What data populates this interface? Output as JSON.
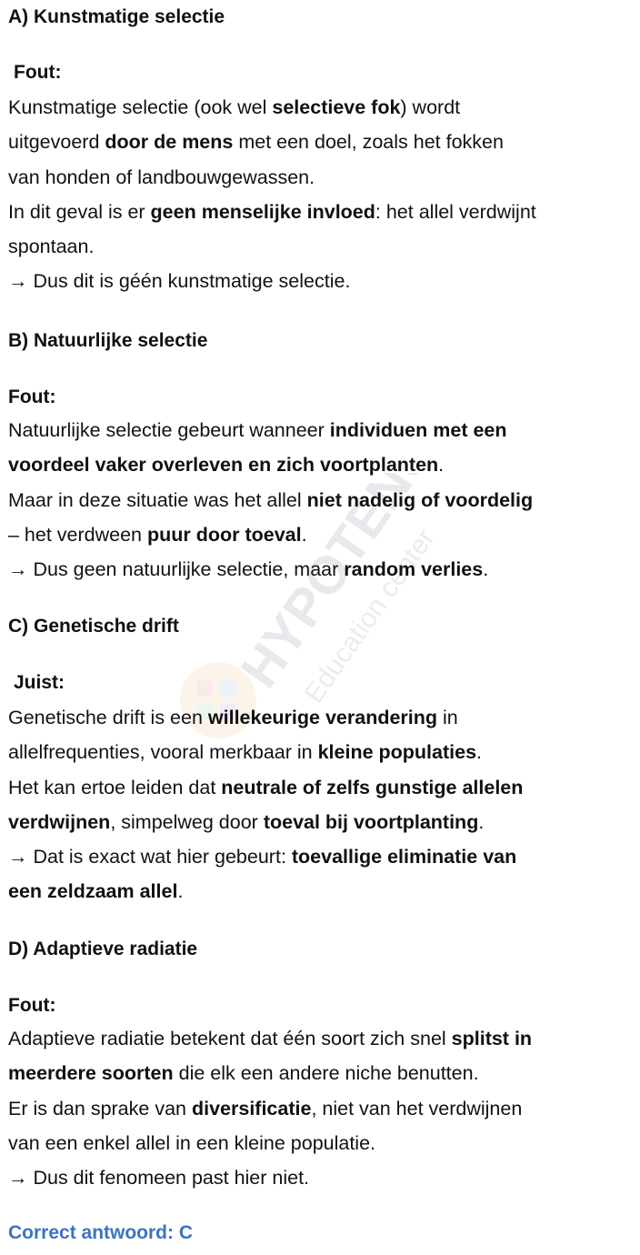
{
  "watermark": {
    "brand": "HYPOTENUSE",
    "subtitle": "Education center"
  },
  "sections": [
    {
      "title": "A) Kunstmatige selectie",
      "verdict": "Fout:",
      "lines": [
        [
          [
            "Kunstmatige selectie (ook wel ",
            false
          ],
          [
            "selectieve fok",
            true
          ],
          [
            ") wordt",
            false
          ]
        ],
        [
          [
            "uitgevoerd ",
            false
          ],
          [
            "door de mens",
            true
          ],
          [
            " met een doel, zoals het fokken",
            false
          ]
        ],
        [
          [
            "van honden of landbouwgewassen.",
            false
          ]
        ],
        [
          [
            "In dit geval is er ",
            false
          ],
          [
            "geen menselijke invloed",
            true
          ],
          [
            ": het allel verdwijnt",
            false
          ]
        ],
        [
          [
            "spontaan.",
            false
          ]
        ],
        [
          [
            "→ Dus dit is géén kunstmatige selectie.",
            false
          ]
        ]
      ]
    },
    {
      "title": "B) Natuurlijke selectie",
      "verdict": "Fout:",
      "lines": [
        [
          [
            "Natuurlijke selectie gebeurt wanneer ",
            false
          ],
          [
            "individuen met een",
            true
          ]
        ],
        [
          [
            "voordeel vaker overleven en zich voortplanten",
            true
          ],
          [
            ".",
            false
          ]
        ],
        [
          [
            "Maar in deze situatie was het allel ",
            false
          ],
          [
            "niet nadelig of voordelig",
            true
          ]
        ],
        [
          [
            "– het verdween ",
            false
          ],
          [
            "puur door toeval",
            true
          ],
          [
            ".",
            false
          ]
        ],
        [
          [
            "→ Dus geen natuurlijke selectie, maar ",
            false
          ],
          [
            "random verlies",
            true
          ],
          [
            ".",
            false
          ]
        ]
      ]
    },
    {
      "title": "C) Genetische drift",
      "verdict": "Juist:",
      "lines": [
        [
          [
            "Genetische drift is een ",
            false
          ],
          [
            "willekeurige verandering",
            true
          ],
          [
            " in",
            false
          ]
        ],
        [
          [
            "allelfrequenties, vooral merkbaar in ",
            false
          ],
          [
            "kleine populaties",
            true
          ],
          [
            ".",
            false
          ]
        ],
        [
          [
            "Het kan ertoe leiden dat ",
            false
          ],
          [
            "neutrale of zelfs gunstige allelen",
            true
          ]
        ],
        [
          [
            "verdwijnen",
            true
          ],
          [
            ", simpelweg door ",
            false
          ],
          [
            "toeval bij voortplanting",
            true
          ],
          [
            ".",
            false
          ]
        ],
        [
          [
            "→ Dat is exact wat hier gebeurt: ",
            false
          ],
          [
            "toevallige eliminatie van",
            true
          ]
        ],
        [
          [
            "een zeldzaam allel",
            true
          ],
          [
            ".",
            false
          ]
        ]
      ]
    },
    {
      "title": "D) Adaptieve radiatie",
      "verdict": "Fout:",
      "lines": [
        [
          [
            "Adaptieve radiatie betekent dat één soort zich snel ",
            false
          ],
          [
            "splitst in",
            true
          ]
        ],
        [
          [
            "meerdere soorten",
            true
          ],
          [
            " die elk een andere niche benutten.",
            false
          ]
        ],
        [
          [
            "Er is dan sprake van ",
            false
          ],
          [
            "diversificatie",
            true
          ],
          [
            ", niet van het verdwijnen",
            false
          ]
        ],
        [
          [
            "van een enkel allel in een kleine populatie.",
            false
          ]
        ],
        [
          [
            "→ Dus dit fenomeen past hier niet.",
            false
          ]
        ]
      ]
    }
  ],
  "answer": "Correct antwoord: C",
  "colors": {
    "text": "#111111",
    "answer": "#3a74c0"
  }
}
